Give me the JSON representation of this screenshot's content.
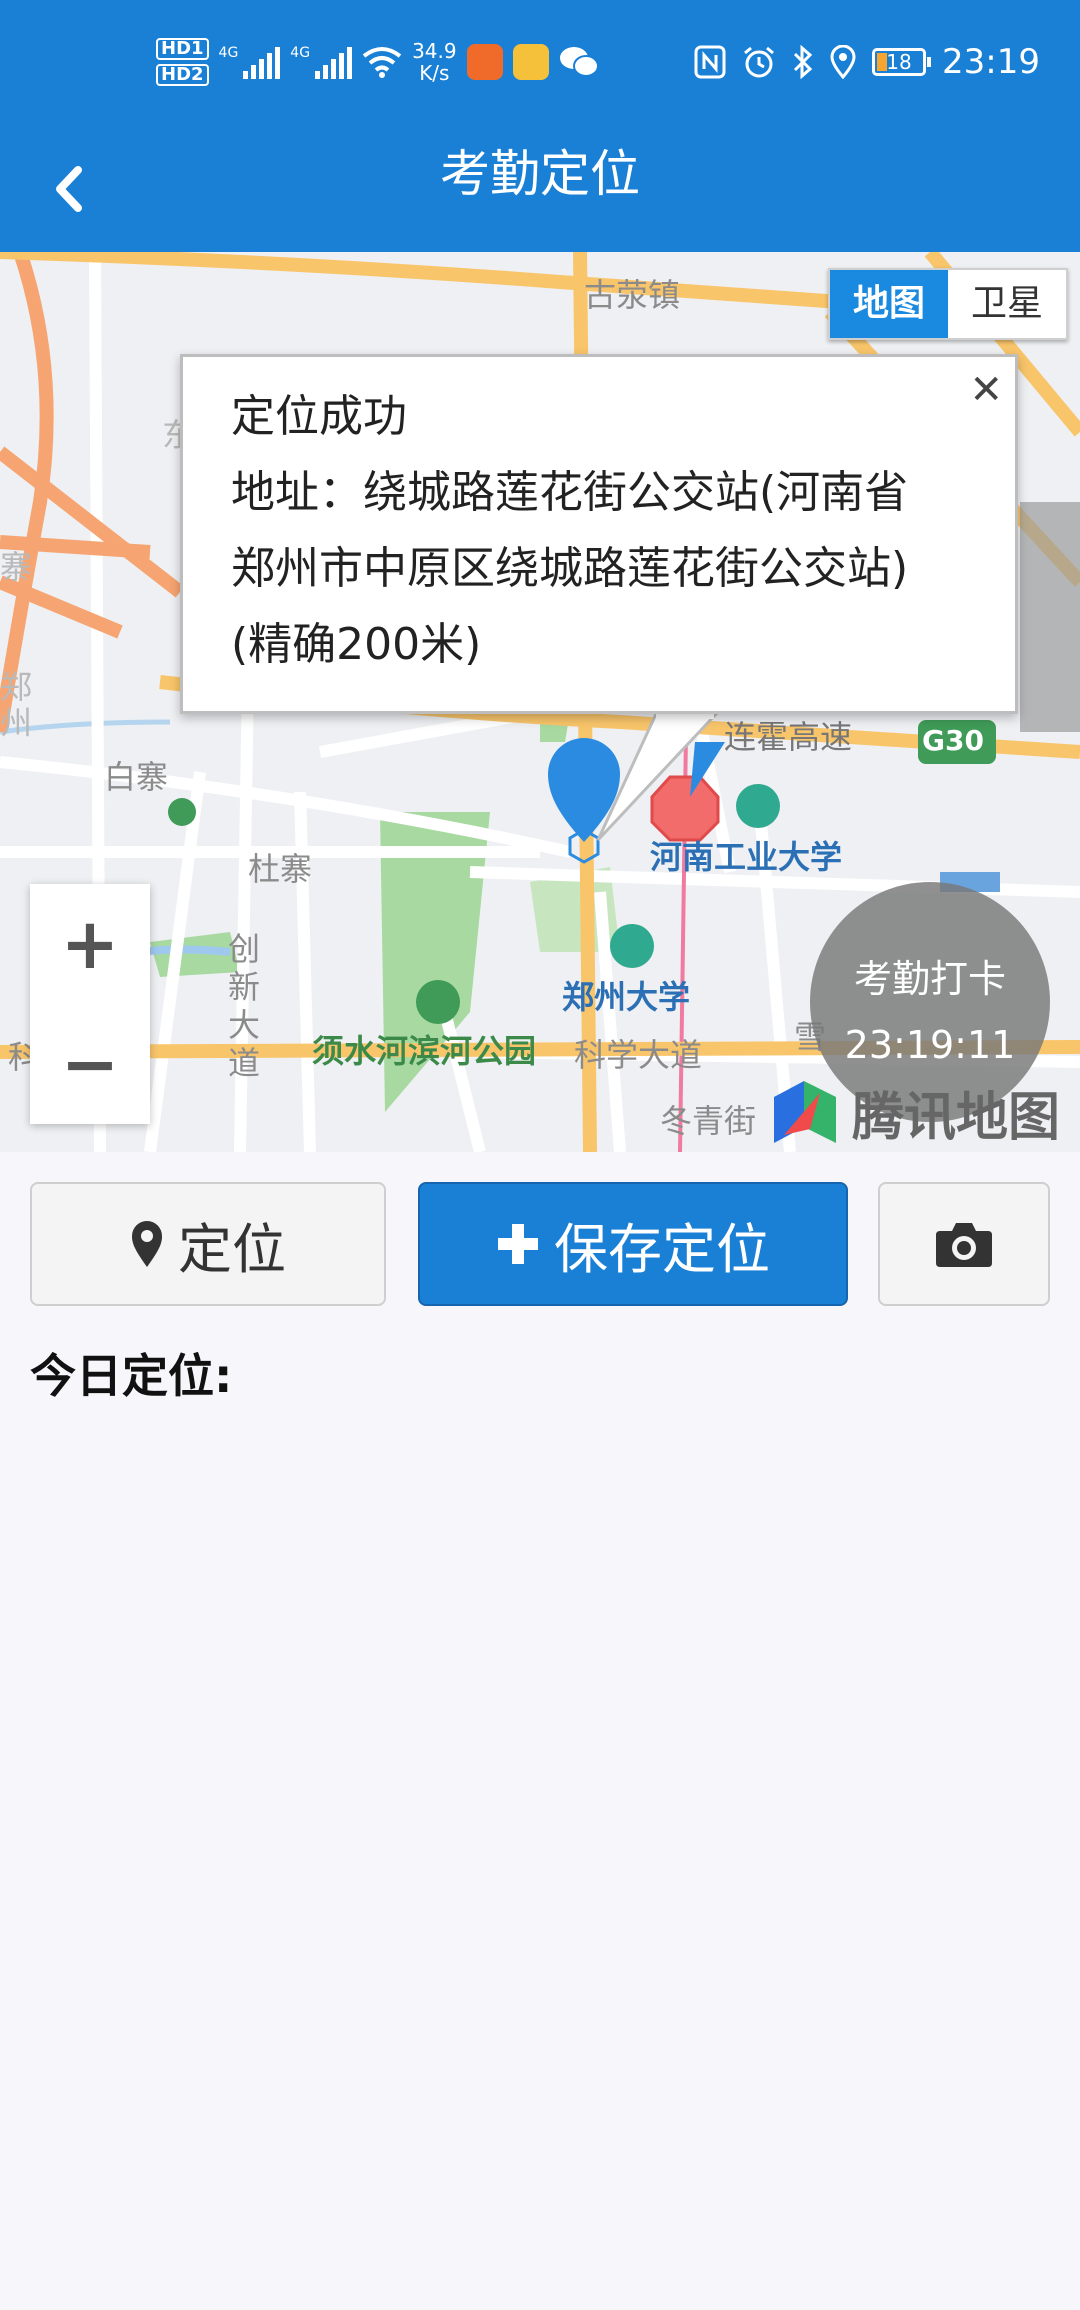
{
  "status_bar": {
    "hd1": "HD1",
    "hd2": "HD2",
    "net1": "4G",
    "net2": "4G",
    "speed_value": "34.9",
    "speed_unit": "K/s",
    "battery": "18",
    "time": "23:19"
  },
  "header": {
    "title": "考勤定位"
  },
  "map": {
    "type_map": "地图",
    "type_satellite": "卫星",
    "zoom_in": "+",
    "zoom_out": "−",
    "popup": {
      "title": "定位成功",
      "line1": "地址：绕城路莲花街公交站(河南省",
      "line2": "郑州市中原区绕城路莲花街公交站)",
      "line3": "(精确200米)"
    },
    "clock": {
      "label": "考勤打卡",
      "time": "23:19:11"
    },
    "brand": "腾讯地图",
    "labels": {
      "gurong": "古荥镇",
      "baizhai": "白寨",
      "duzhai": "杜寨",
      "chuangxin": "创新大道",
      "hngydx": "河南工业大学",
      "zzdx": "郑州大学",
      "xushui": "须水河滨河公园",
      "kexue": "科学大道",
      "dongqing": "冬青街",
      "lianhuo": "连霍高速",
      "g30": "G30",
      "ke": "科",
      "dao": "道",
      "xue": "雪",
      "dong": "东",
      "zhai": "寨",
      "zheng": "郑",
      "zhou": "州"
    }
  },
  "actions": {
    "locate": "定位",
    "save": "保存定位"
  },
  "today_label": "今日定位:",
  "colors": {
    "primary": "#1a80d6",
    "highway": "#f9c56a",
    "expressway": "#f6a471",
    "park": "#a8d9a0"
  }
}
